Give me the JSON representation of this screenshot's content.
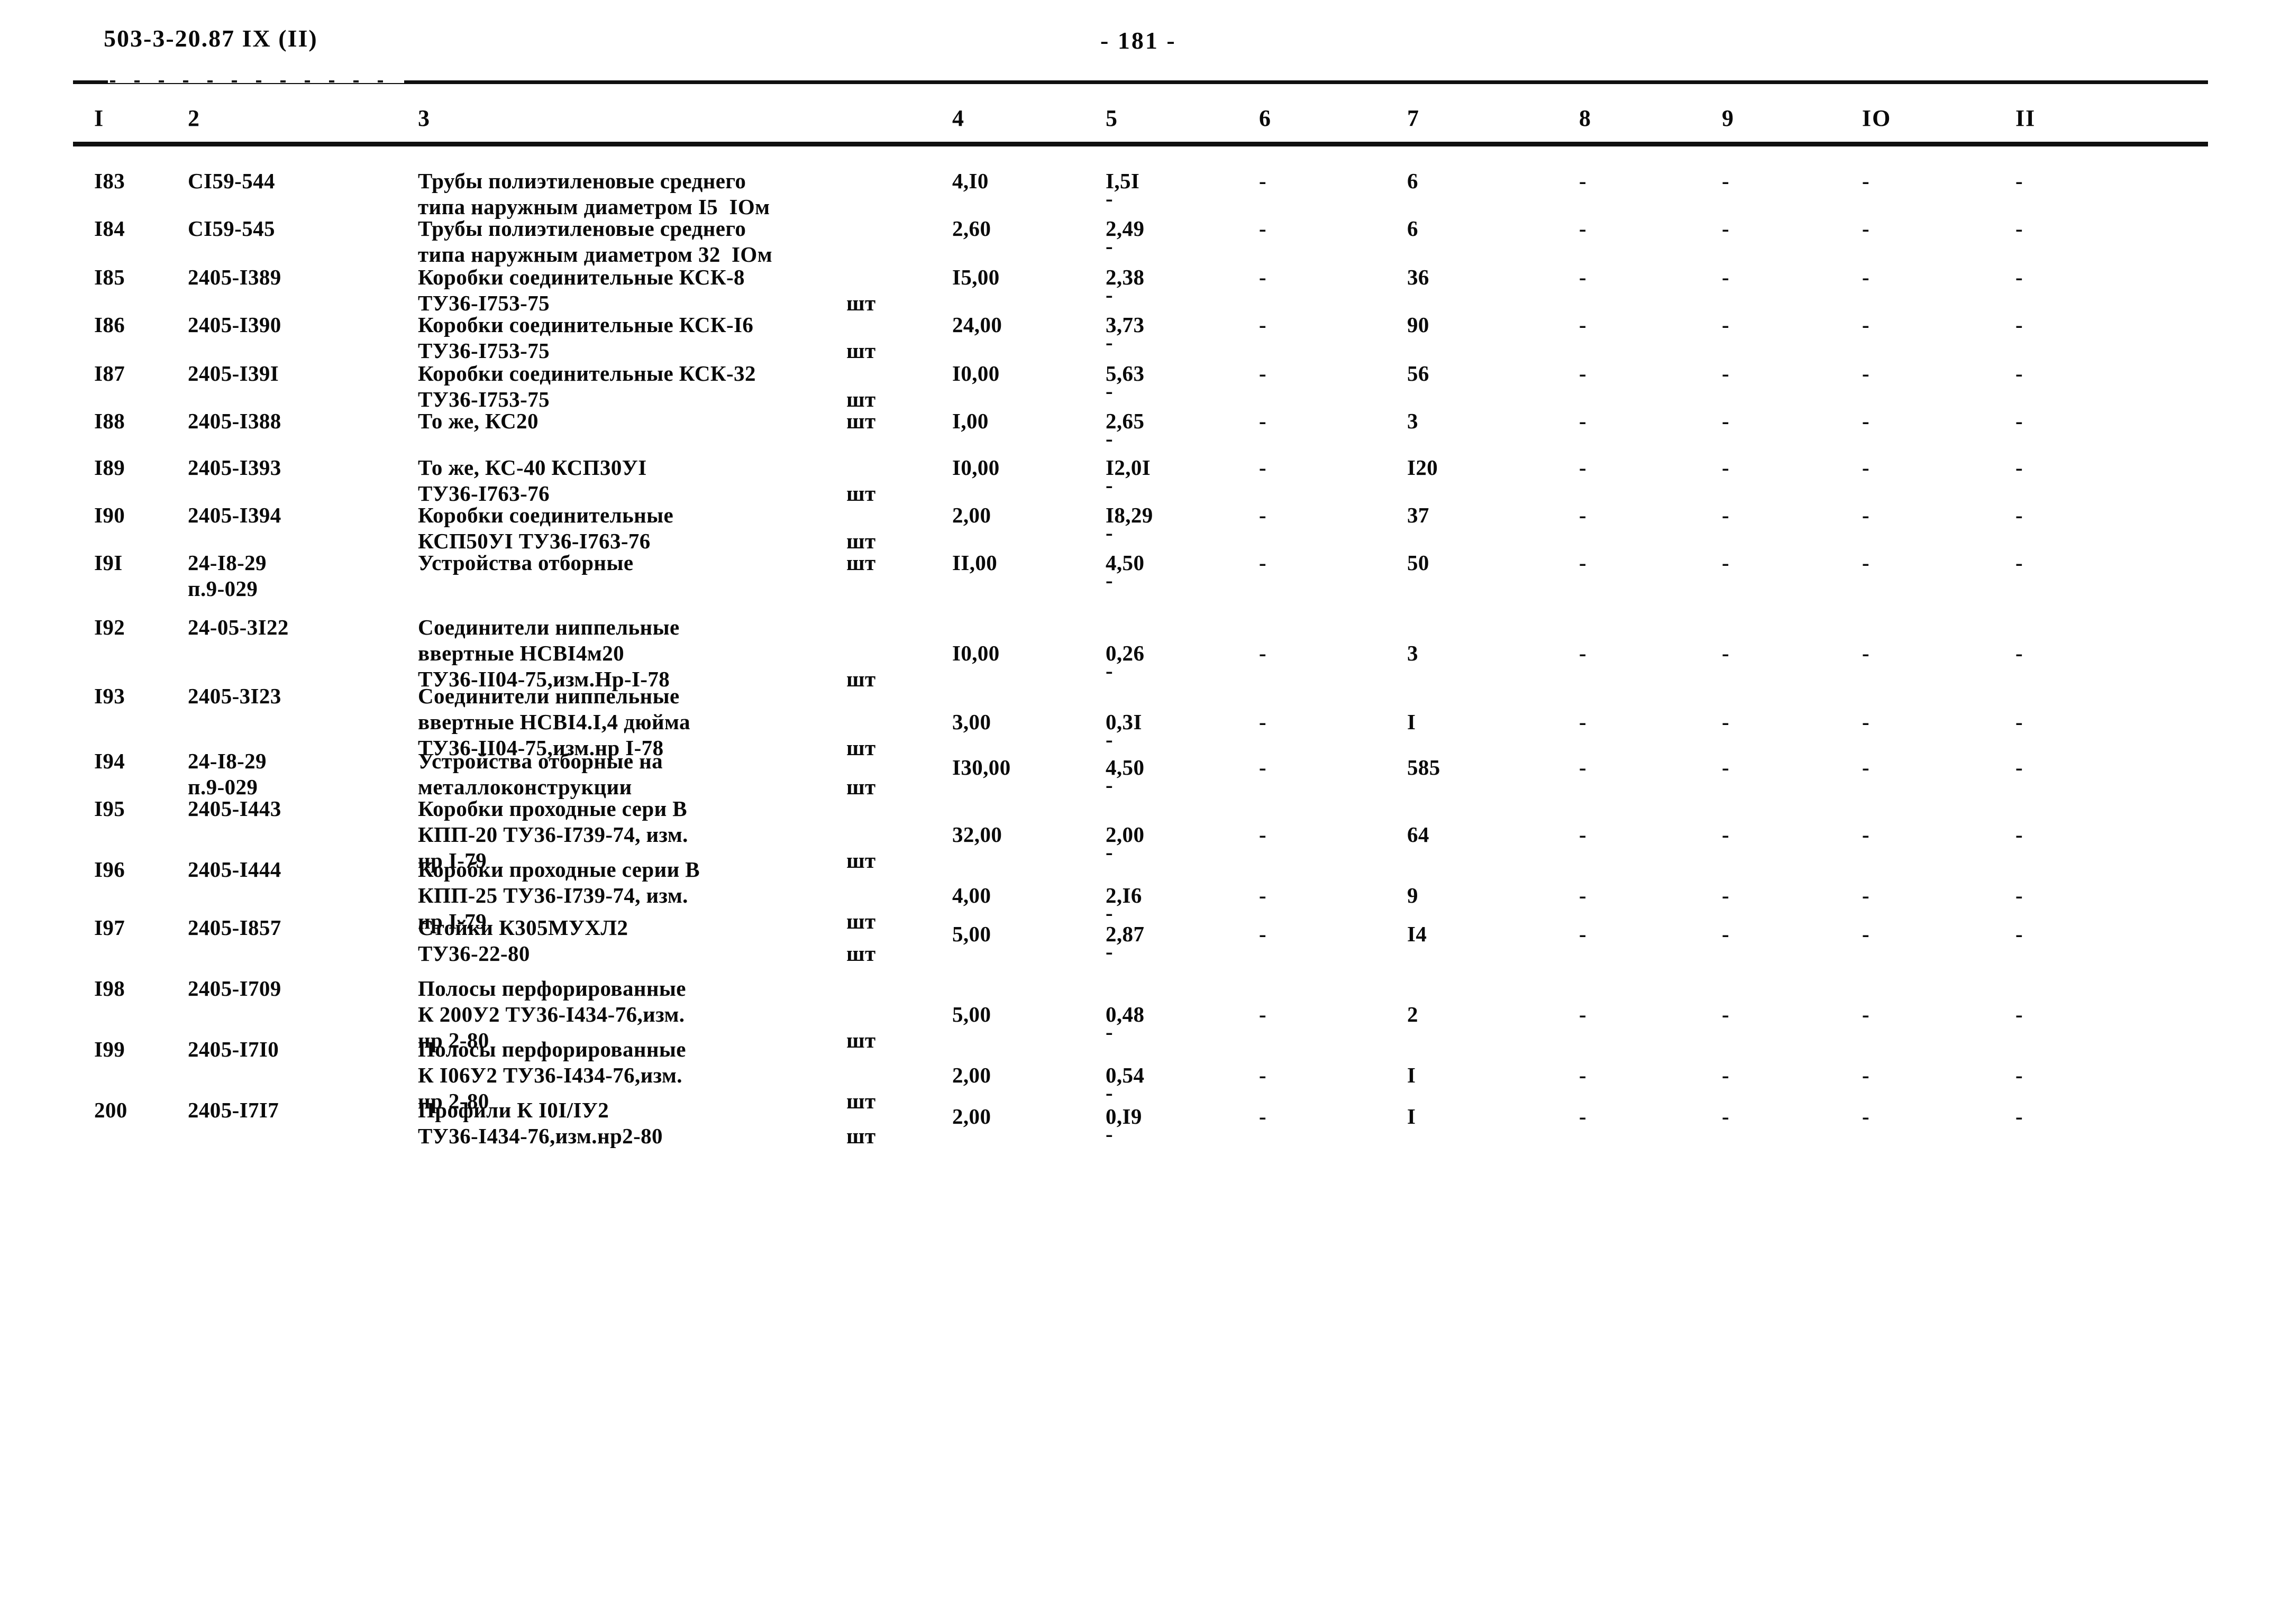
{
  "header": {
    "doc_code": "503-3-20.87  IX (II)",
    "page_number": "- 181 -"
  },
  "table": {
    "column_headers": [
      "I",
      "2",
      "3",
      "4",
      "5",
      "6",
      "7",
      "8",
      "9",
      "IO",
      "II"
    ],
    "dash": "-",
    "unit_shtuka": "шт",
    "rows": [
      {
        "no": "I83",
        "code": "CI59-544",
        "desc_lines": [
          "Трубы полиэтиленовые среднего",
          "типа наружным диаметром I5  IOм"
        ],
        "unit": "",
        "c4": "4,I0",
        "c5": "I,5I",
        "c6": "-",
        "c7": "6",
        "c8": "-",
        "c9": "-",
        "c10": "-",
        "c11": "-",
        "sub_dash": "-"
      },
      {
        "no": "I84",
        "code": "CI59-545",
        "desc_lines": [
          "Трубы полиэтиленовые среднего",
          "типа наружным диаметром 32  IOм"
        ],
        "unit": "",
        "c4": "2,60",
        "c5": "2,49",
        "c6": "-",
        "c7": "6",
        "c8": "-",
        "c9": "-",
        "c10": "-",
        "c11": "-",
        "sub_dash": "-"
      },
      {
        "no": "I85",
        "code": "2405-I389",
        "desc_lines": [
          "Коробки соединительные КСК-8",
          "ТУ36-I753-75"
        ],
        "unit": "шт",
        "c4": "I5,00",
        "c5": "2,38",
        "c6": "-",
        "c7": "36",
        "c8": "-",
        "c9": "-",
        "c10": "-",
        "c11": "-",
        "sub_dash": "-"
      },
      {
        "no": "I86",
        "code": "2405-I390",
        "desc_lines": [
          "Коробки соединительные КСК-I6",
          "ТУ36-I753-75"
        ],
        "unit": "шт",
        "c4": "24,00",
        "c5": "3,73",
        "c6": "-",
        "c7": "90",
        "c8": "-",
        "c9": "-",
        "c10": "-",
        "c11": "-",
        "sub_dash": "-"
      },
      {
        "no": "I87",
        "code": "2405-I39I",
        "desc_lines": [
          "Коробки соединительные КСК-32",
          "ТУ36-I753-75"
        ],
        "unit": "шт",
        "c4": "I0,00",
        "c5": "5,63",
        "c6": "-",
        "c7": "56",
        "c8": "-",
        "c9": "-",
        "c10": "-",
        "c11": "-",
        "sub_dash": "-"
      },
      {
        "no": "I88",
        "code": "2405-I388",
        "desc_lines": [
          "То же, КС20"
        ],
        "unit": "шт",
        "c4": "I,00",
        "c5": "2,65",
        "c6": "-",
        "c7": "3",
        "c8": "-",
        "c9": "-",
        "c10": "-",
        "c11": "-",
        "sub_dash": "-"
      },
      {
        "no": "I89",
        "code": "2405-I393",
        "desc_lines": [
          "То же, КС-40 КСП30УI",
          "ТУ36-I763-76"
        ],
        "unit": "шт",
        "c4": "I0,00",
        "c5": "I2,0I",
        "c6": "-",
        "c7": "I20",
        "c8": "-",
        "c9": "-",
        "c10": "-",
        "c11": "-",
        "sub_dash": "-"
      },
      {
        "no": "I90",
        "code": "2405-I394",
        "desc_lines": [
          "Коробки соединительные",
          "КСП50УI ТУ36-I763-76"
        ],
        "unit": "шт",
        "c4": "2,00",
        "c5": "I8,29",
        "c6": "-",
        "c7": "37",
        "c8": "-",
        "c9": "-",
        "c10": "-",
        "c11": "-",
        "sub_dash": "-"
      },
      {
        "no": "I9I",
        "code": "24-I8-29\nп.9-029",
        "desc_lines": [
          "Устройства отборные"
        ],
        "unit": "шт",
        "c4": "II,00",
        "c5": "4,50",
        "c6": "-",
        "c7": "50",
        "c8": "-",
        "c9": "-",
        "c10": "-",
        "c11": "-",
        "sub_dash": "-"
      },
      {
        "no": "I92",
        "code": "24-05-3I22",
        "desc_lines": [
          "Соединители ниппельные",
          "ввертные НСВI4м20",
          "ТУ36-II04-75,изм.Нр-I-78"
        ],
        "unit": "шт",
        "c4": "I0,00",
        "c5": "0,26",
        "c6": "-",
        "c7": "3",
        "c8": "-",
        "c9": "-",
        "c10": "-",
        "c11": "-",
        "sub_dash": "-"
      },
      {
        "no": "I93",
        "code": "2405-3I23",
        "desc_lines": [
          "Соединители ниппельные",
          "ввертные НСВI4.I,4 дюйма",
          "ТУ36-II04-75,изм.нр I-78"
        ],
        "unit": "шт",
        "c4": "3,00",
        "c5": "0,3I",
        "c6": "-",
        "c7": "I",
        "c8": "-",
        "c9": "-",
        "c10": "-",
        "c11": "-",
        "sub_dash": "-"
      },
      {
        "no": "I94",
        "code": "24-I8-29\nп.9-029",
        "desc_lines": [
          "Устройства отборные на",
          "металлоконструкции"
        ],
        "unit": "шт",
        "c4": "I30,00",
        "c5": "4,50",
        "c6": "-",
        "c7": "585",
        "c8": "-",
        "c9": "-",
        "c10": "-",
        "c11": "-",
        "sub_dash": "-"
      },
      {
        "no": "I95",
        "code": "2405-I443",
        "desc_lines": [
          "Коробки проходные сери В",
          "КПП-20 ТУ36-I739-74, изм.",
          "нр I-79"
        ],
        "unit": "шт",
        "c4": "32,00",
        "c5": "2,00",
        "c6": "-",
        "c7": "64",
        "c8": "-",
        "c9": "-",
        "c10": "-",
        "c11": "-",
        "sub_dash": "-"
      },
      {
        "no": "I96",
        "code": "2405-I444",
        "desc_lines": [
          "Коробки проходные серии В",
          "КПП-25 ТУ36-I739-74, изм.",
          "нр I-79"
        ],
        "unit": "шт",
        "c4": "4,00",
        "c5": "2,I6",
        "c6": "-",
        "c7": "9",
        "c8": "-",
        "c9": "-",
        "c10": "-",
        "c11": "-",
        "sub_dash": "-"
      },
      {
        "no": "I97",
        "code": "2405-I857",
        "desc_lines": [
          "Стойки К305МУХЛ2",
          "ТУ36-22-80"
        ],
        "unit": "шт",
        "c4": "5,00",
        "c5": "2,87",
        "c6": "-",
        "c7": "I4",
        "c8": "-",
        "c9": "-",
        "c10": "-",
        "c11": "-",
        "sub_dash": "-"
      },
      {
        "no": "I98",
        "code": "2405-I709",
        "desc_lines": [
          "Полосы перфорированные",
          "К 200У2 ТУ36-I434-76,изм.",
          "нр 2-80"
        ],
        "unit": "шт",
        "c4": "5,00",
        "c5": "0,48",
        "c6": "-",
        "c7": "2",
        "c8": "-",
        "c9": "-",
        "c10": "-",
        "c11": "-",
        "sub_dash": "-"
      },
      {
        "no": "I99",
        "code": "2405-I7I0",
        "desc_lines": [
          "Полосы перфорированные",
          "К I06У2 ТУ36-I434-76,изм.",
          "нр 2-80"
        ],
        "unit": "шт",
        "c4": "2,00",
        "c5": "0,54",
        "c6": "-",
        "c7": "I",
        "c8": "-",
        "c9": "-",
        "c10": "-",
        "c11": "-",
        "sub_dash": "-"
      },
      {
        "no": "200",
        "code": "2405-I7I7",
        "desc_lines": [
          "Профили К I0I/IУ2",
          "ТУ36-I434-76,изм.нр2-80"
        ],
        "unit": "шт",
        "c4": "2,00",
        "c5": "0,I9",
        "c6": "-",
        "c7": "I",
        "c8": "-",
        "c9": "-",
        "c10": "-",
        "c11": "-",
        "sub_dash": "-"
      }
    ]
  }
}
